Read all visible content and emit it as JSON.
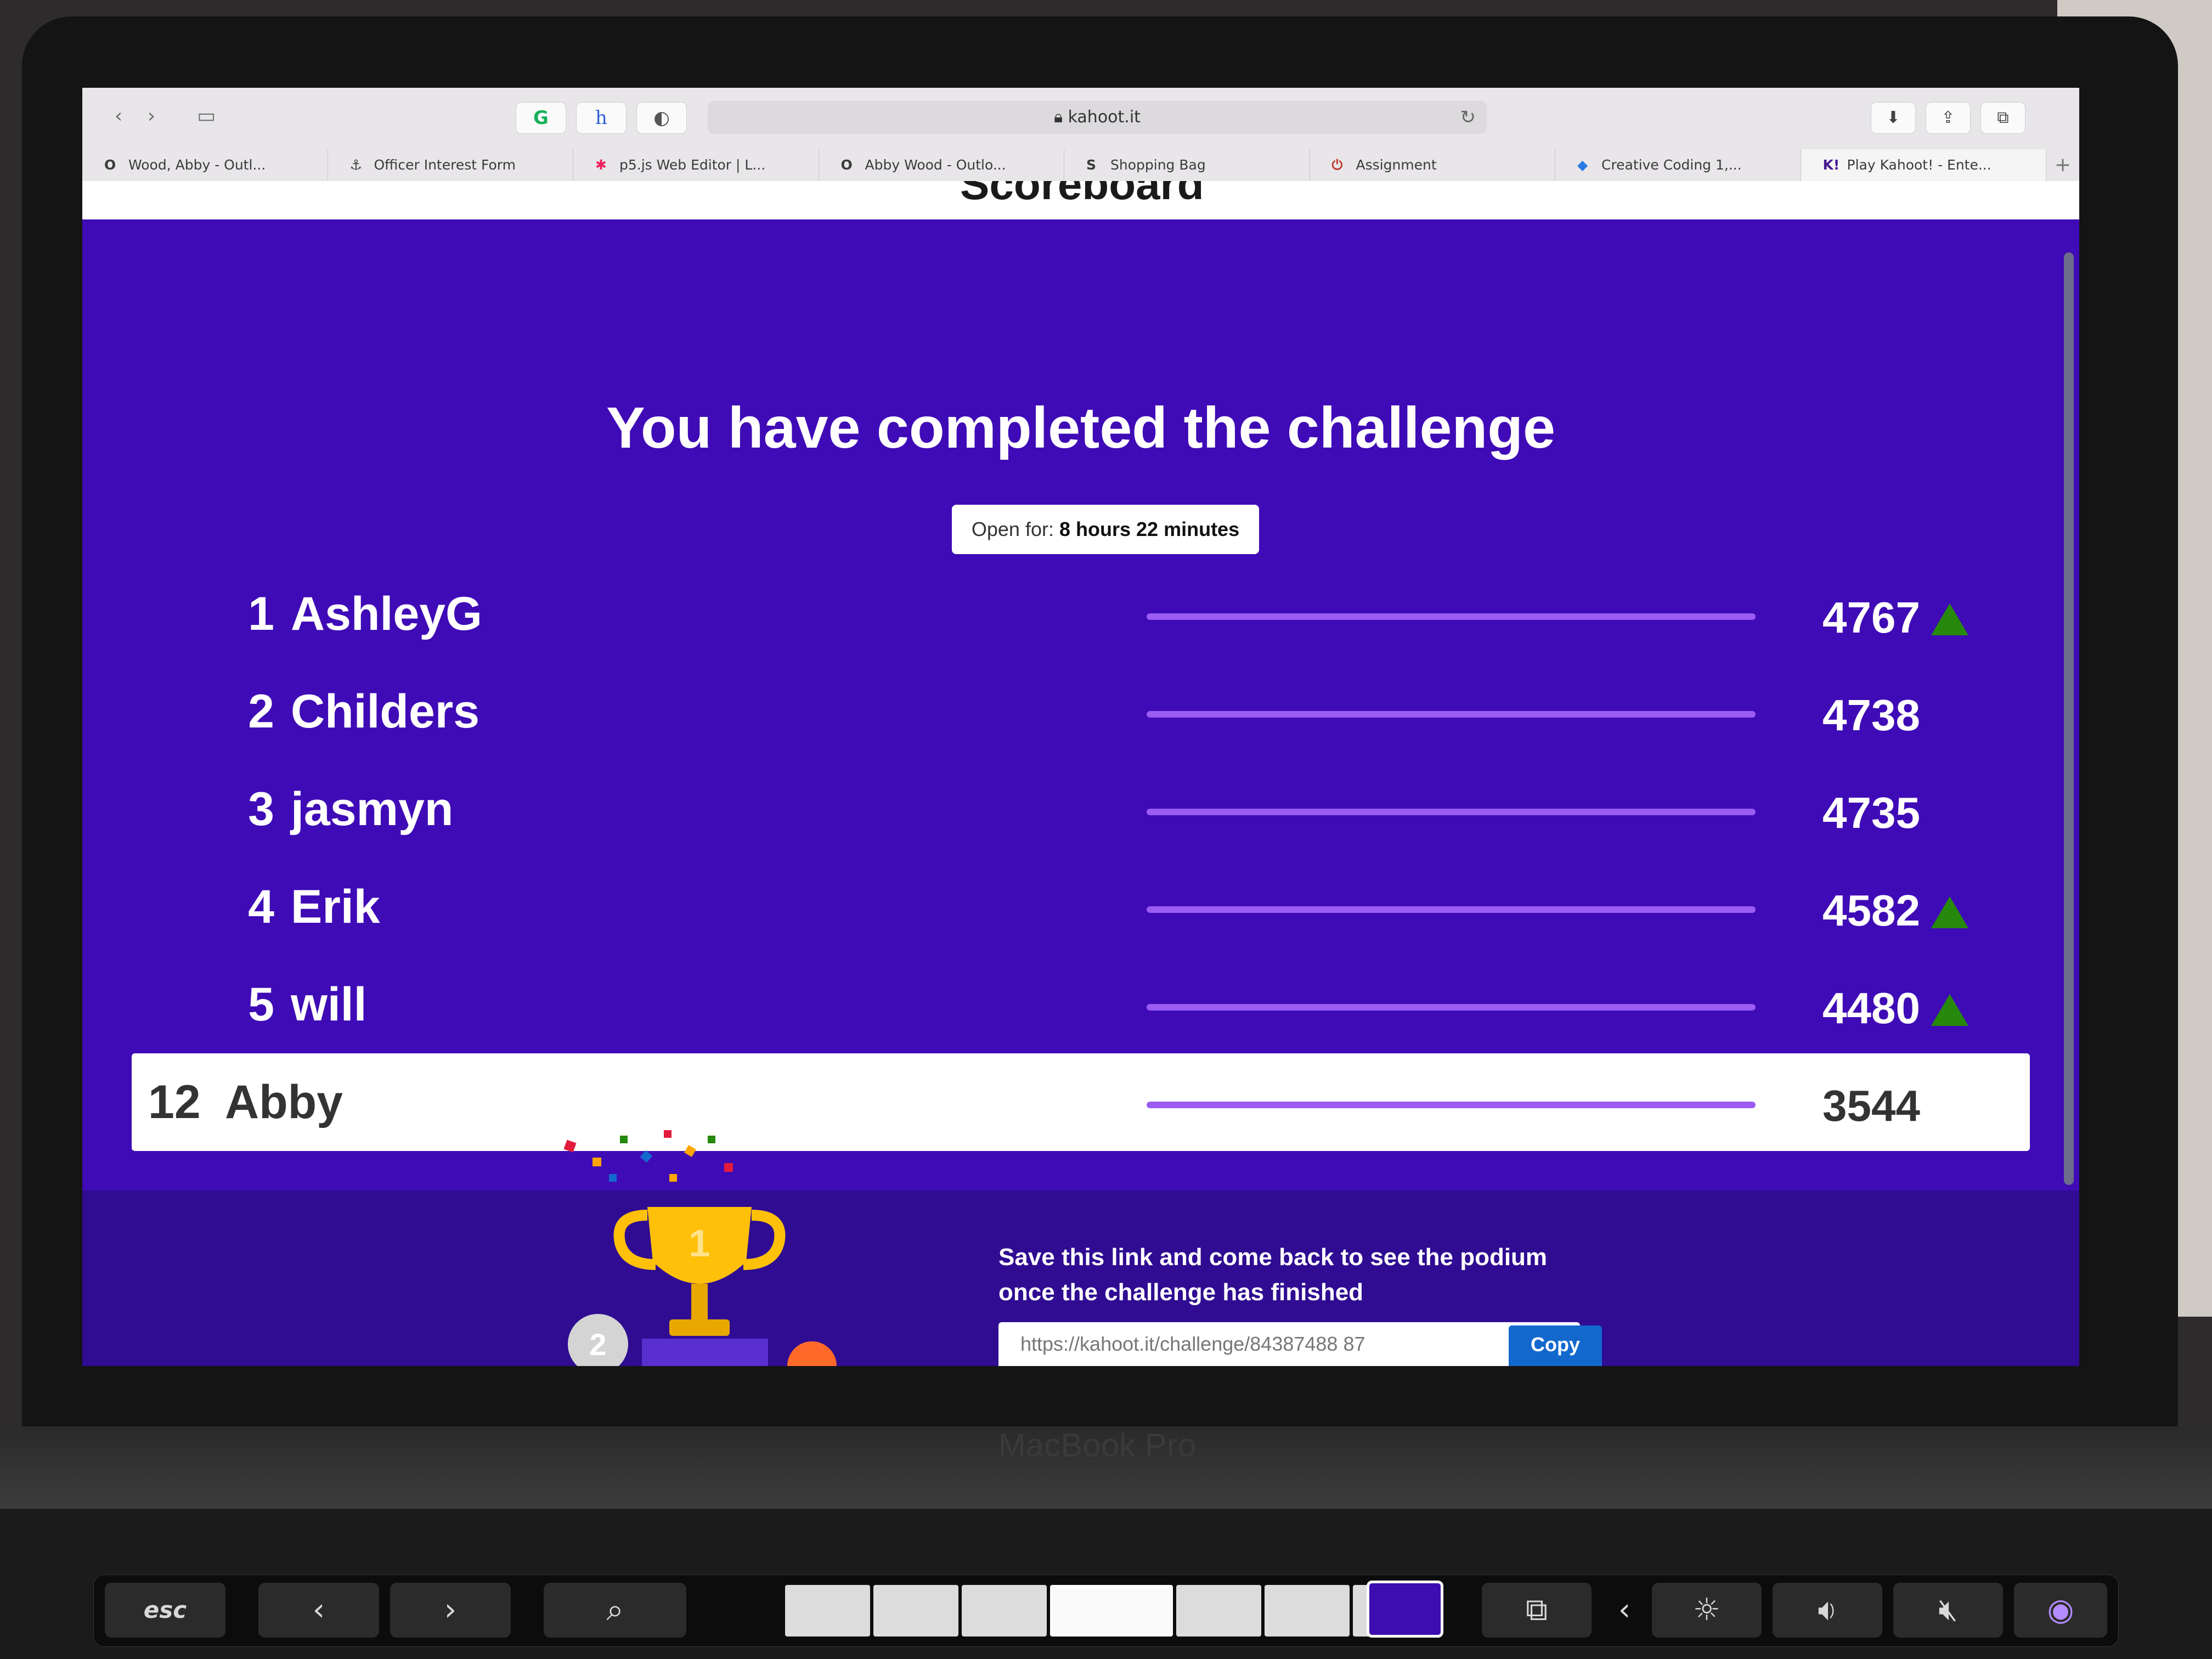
{
  "browser": {
    "address": "kahoot.it",
    "lock_icon": "lock-icon",
    "tabs": [
      {
        "label": "Wood, Abby - Outl...",
        "icon": "O"
      },
      {
        "label": "Officer Interest Form",
        "icon": "⚓"
      },
      {
        "label": "p5.js Web Editor | L...",
        "icon": "✱"
      },
      {
        "label": "Abby Wood - Outlo...",
        "icon": "O"
      },
      {
        "label": "Shopping Bag",
        "icon": "S"
      },
      {
        "label": "Assignment",
        "icon": "⏻"
      },
      {
        "label": "Creative Coding 1,...",
        "icon": "◆"
      },
      {
        "label": "Play Kahoot! - Ente...",
        "icon": "K!"
      }
    ]
  },
  "page": {
    "partial_title": "Scoreboard",
    "heading": "You have completed the challenge",
    "open_for_label": "Open for:",
    "open_for_value": "8 hours 22 minutes"
  },
  "leaderboard": [
    {
      "rank": "1",
      "name": "AshleyG",
      "score": "4767",
      "progress": 1.0,
      "trend_up": true
    },
    {
      "rank": "2",
      "name": "Childers",
      "score": "4738",
      "progress": 1.0,
      "trend_up": false
    },
    {
      "rank": "3",
      "name": "jasmyn",
      "score": "4735",
      "progress": 1.0,
      "trend_up": false
    },
    {
      "rank": "4",
      "name": "Erik",
      "score": "4582",
      "progress": 1.0,
      "trend_up": true
    },
    {
      "rank": "5",
      "name": "will",
      "score": "4480",
      "progress": 1.0,
      "trend_up": true
    },
    {
      "rank": "12",
      "name": "Abby",
      "score": "3544",
      "progress": 1.0,
      "trend_up": false,
      "is_current_user": true
    }
  ],
  "podium": {
    "save_text_line1": "Save this link and come back to see the podium",
    "save_text_line2": "once the challenge has finished",
    "link_value": "https://kahoot.it/challenge/84387488 87",
    "copy_label": "Copy",
    "trophy_number": "1",
    "medal_number": "2"
  },
  "laptop": {
    "brand": "MacBook Pro",
    "touchbar_esc": "esc"
  },
  "colors": {
    "page_bg": "#3f0bb6",
    "bar_fill": "#9a5cf2",
    "trend_up": "#26890c",
    "copy_button": "#1368ce"
  }
}
